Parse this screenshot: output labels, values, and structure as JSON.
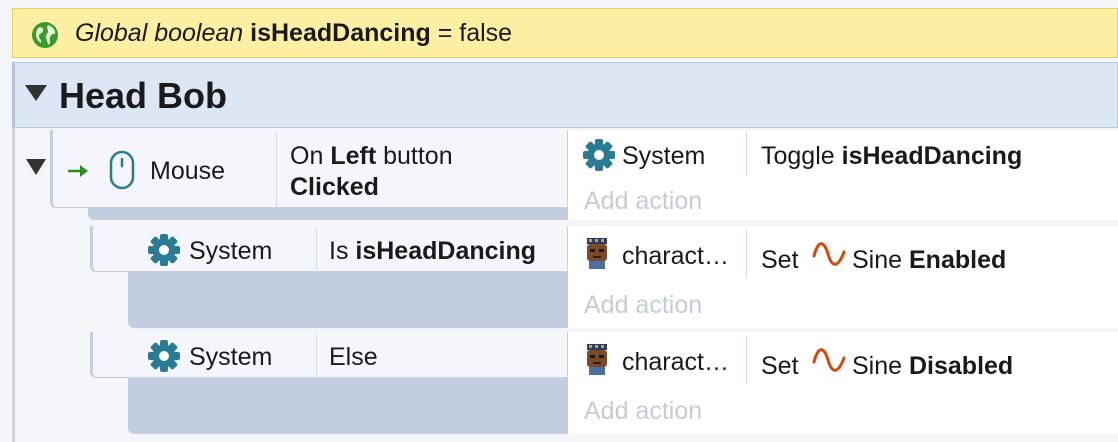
{
  "global_var": {
    "prefix": "Global boolean",
    "name": "isHeadDancing",
    "suffix": "= false",
    "icon": "globe-icon"
  },
  "group": {
    "title": "Head Bob"
  },
  "events": [
    {
      "condition": {
        "object": "Mouse",
        "line1_pre": "On",
        "line1_bold": "Left",
        "line1_post": "button",
        "line2": "Clicked"
      },
      "action": {
        "object": "System",
        "verb": "Toggle",
        "param": "isHeadDancing"
      },
      "add_action": "Add action"
    },
    {
      "condition": {
        "object": "System",
        "verb": "Is",
        "param": "isHeadDancing"
      },
      "action": {
        "object": "charact…",
        "verb": "Set",
        "behavior": "Sine",
        "state": "Enabled"
      },
      "add_action": "Add action"
    },
    {
      "condition": {
        "object": "System",
        "verb": "Else"
      },
      "action": {
        "object": "charact…",
        "verb": "Set",
        "behavior": "Sine",
        "state": "Disabled"
      },
      "add_action": "Add action"
    }
  ],
  "colors": {
    "gear": "#2a7c94",
    "sine": "#d9470b",
    "arrow": "#2e8b1e",
    "globe": "#3a9a2e",
    "banner_bg": "#fdefa1",
    "group_bg": "#dce6f4"
  }
}
